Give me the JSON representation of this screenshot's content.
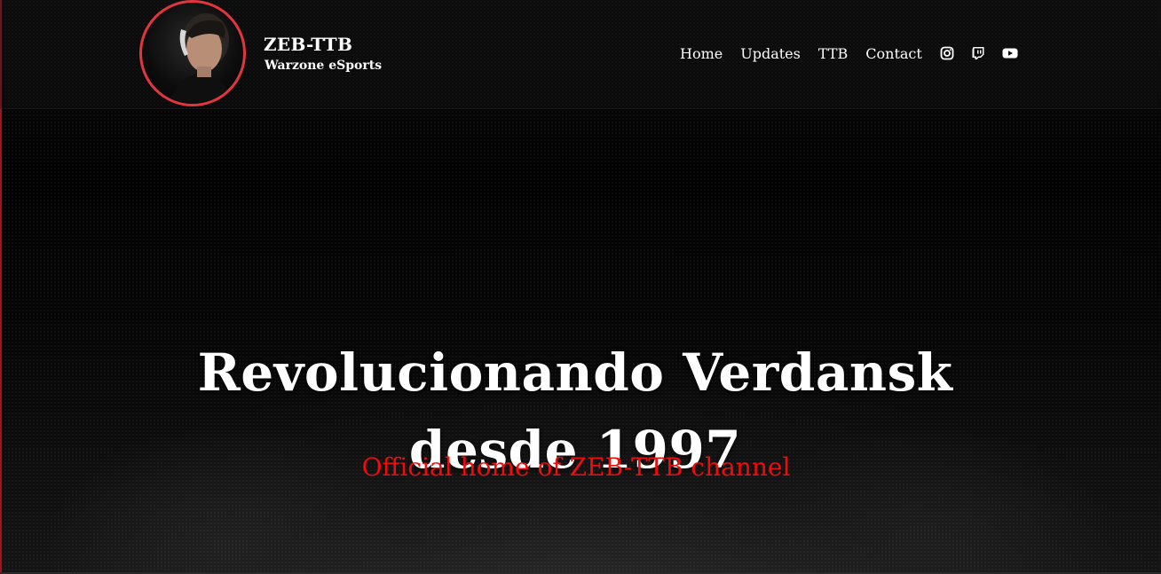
{
  "brand": {
    "title": "ZEB-TTB",
    "subtitle": "Warzone eSports",
    "accent_color": "#e2363e"
  },
  "nav": {
    "links": [
      {
        "label": "Home"
      },
      {
        "label": "Updates"
      },
      {
        "label": "TTB"
      },
      {
        "label": "Contact"
      }
    ],
    "social_icons": [
      {
        "icon": "instagram-icon"
      },
      {
        "icon": "twitch-icon"
      },
      {
        "icon": "youtube-icon"
      }
    ]
  },
  "hero": {
    "headline_line1": "Revolucionando Verdansk",
    "headline_line2": "desde 1997",
    "tagline": "Official home of ZEB-TTB channel",
    "tagline_color": "#ee0c0c"
  }
}
